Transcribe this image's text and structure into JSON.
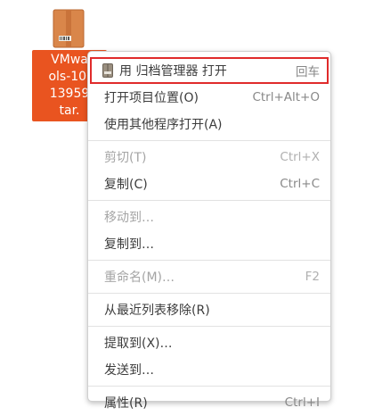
{
  "desktop": {
    "selected_icon": {
      "icon": "archive-package-icon",
      "label_lines": [
        "VMwa",
        "ols-10.",
        "13959",
        "tar."
      ]
    }
  },
  "context_menu": {
    "items": [
      {
        "label": "用 归档管理器 打开",
        "accel": "回车",
        "icon": "archive-manager-icon",
        "disabled": false
      },
      {
        "label": "打开项目位置(O)",
        "accel": "Ctrl+Alt+O",
        "disabled": false
      },
      {
        "label": "使用其他程序打开(A)",
        "accel": "",
        "disabled": false
      },
      {
        "label": "剪切(T)",
        "accel": "Ctrl+X",
        "disabled": true
      },
      {
        "label": "复制(C)",
        "accel": "Ctrl+C",
        "disabled": false
      },
      {
        "label": "移动到…",
        "accel": "",
        "disabled": true
      },
      {
        "label": "复制到…",
        "accel": "",
        "disabled": false
      },
      {
        "label": "重命名(M)…",
        "accel": "F2",
        "disabled": true
      },
      {
        "label": "从最近列表移除(R)",
        "accel": "",
        "disabled": false
      },
      {
        "label": "提取到(X)…",
        "accel": "",
        "disabled": false
      },
      {
        "label": "发送到…",
        "accel": "",
        "disabled": false
      },
      {
        "label": "属性(R)",
        "accel": "Ctrl+I",
        "disabled": false
      }
    ]
  },
  "colors": {
    "selection": "#e95420",
    "highlight_outline": "#e02b2b"
  }
}
